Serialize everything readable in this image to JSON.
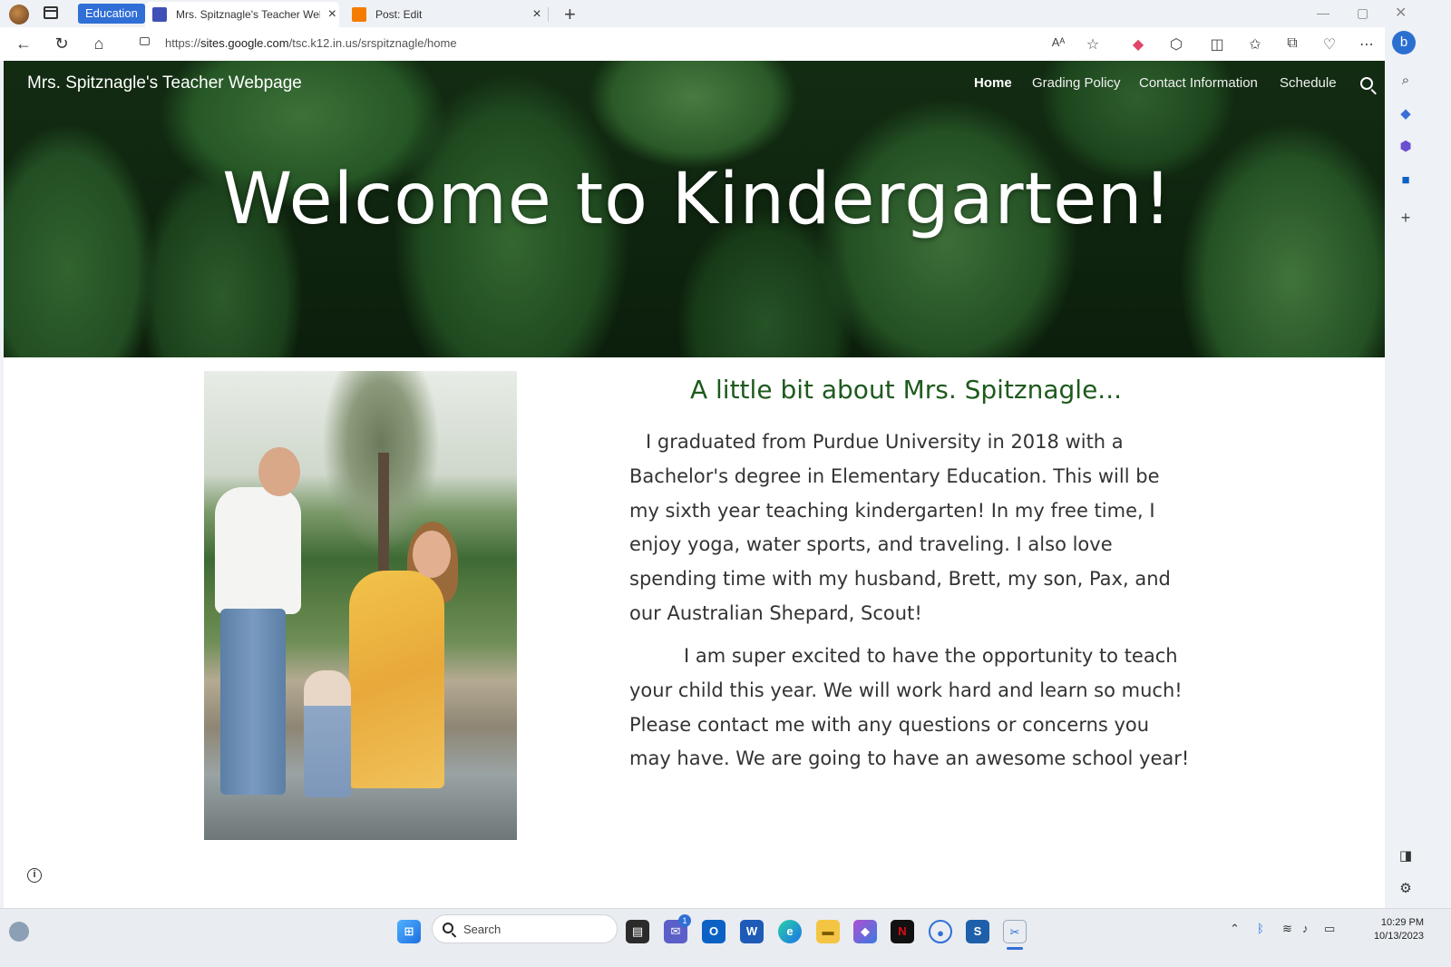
{
  "browser": {
    "workspace_label": "Education",
    "tabs": [
      {
        "label": "Mrs. Spitznagle's Teacher Webpa",
        "active": true
      },
      {
        "label": "Post: Edit",
        "active": false
      }
    ],
    "url_prefix": "https://",
    "url_host": "sites.google.com",
    "url_path": "/tsc.k12.in.us/srspitznagle/home"
  },
  "site": {
    "title": "Mrs. Spitznagle's Teacher Webpage",
    "nav": [
      {
        "label": "Home",
        "active": true
      },
      {
        "label": "Grading Policy",
        "active": false
      },
      {
        "label": "Contact Information",
        "active": false
      },
      {
        "label": "Schedule",
        "active": false
      }
    ],
    "hero_heading": "Welcome to Kindergarten!",
    "about_heading": "A little bit about Mrs. Spitznagle...",
    "paragraph_1": "I graduated from Purdue University in 2018 with a Bachelor's degree in Elementary Education. This will be my sixth year teaching kindergarten! In my free time, I enjoy yoga, water sports, and traveling. I also love spending time with my husband, Brett, my son, Pax, and our Australian Shepard, Scout!",
    "paragraph_2": "I am super excited to have the opportunity to teach your child this year. We will work hard and learn so much! Please contact me with any questions or concerns you may have.  We are going to have an awesome school year!"
  },
  "taskbar": {
    "search_label": "Search",
    "time": "10:29 PM",
    "date": "10/13/2023",
    "teams_badge": "1"
  },
  "icons": {
    "tab_favicon_sites": "google-sites-icon",
    "tab_favicon_blogger": "blogger-icon",
    "accent": "#2f6fd6",
    "heading_green": "#1e5a1e"
  }
}
